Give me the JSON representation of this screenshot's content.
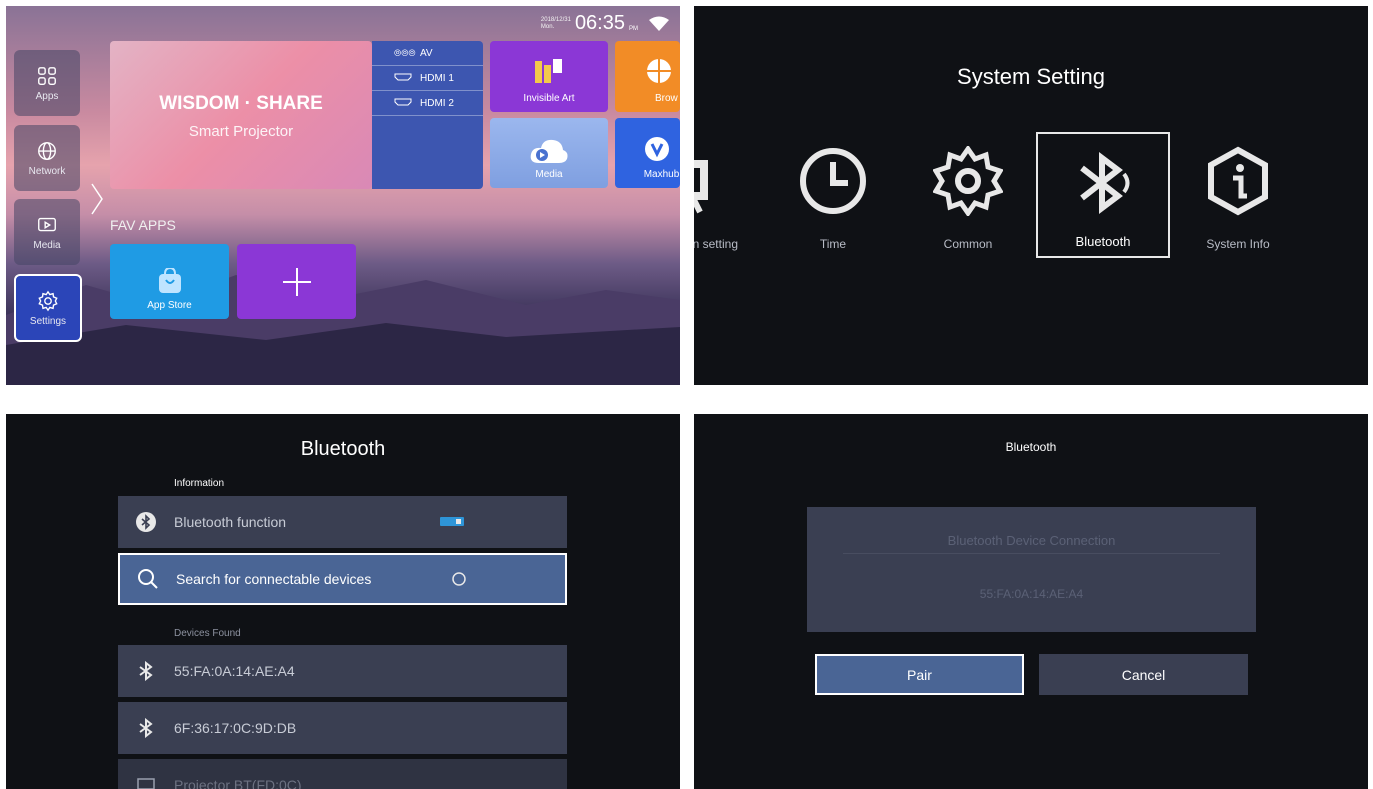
{
  "panel1": {
    "status": {
      "date": "2018/12/31",
      "weekday": "Mon.",
      "time": "06:35",
      "ampm": "PM"
    },
    "sidebar": [
      {
        "label": "Apps",
        "icon": "apps-grid-icon"
      },
      {
        "label": "Network",
        "icon": "globe-icon"
      },
      {
        "label": "Media",
        "icon": "media-play-icon"
      },
      {
        "label": "Settings",
        "icon": "gear-icon"
      }
    ],
    "hero": {
      "title": "WISDOM · SHARE",
      "subtitle": "Smart Projector"
    },
    "sources": [
      {
        "label": "AV",
        "icon": "av-ports-icon"
      },
      {
        "label": "HDMI 1",
        "icon": "hdmi-icon"
      },
      {
        "label": "HDMI 2",
        "icon": "hdmi-icon"
      }
    ],
    "tiles": {
      "invisible_art": "Invisible Art",
      "browser": "Brow",
      "media": "Media",
      "maxhub": "Maxhub"
    },
    "fav_apps_label": "FAV APPS",
    "app_store": "App Store"
  },
  "panel2": {
    "title": "System Setting",
    "items": [
      {
        "label": "on setting",
        "icon": "projection-icon"
      },
      {
        "label": "Time",
        "icon": "clock-icon"
      },
      {
        "label": "Common",
        "icon": "gear-icon"
      },
      {
        "label": "Bluetooth",
        "icon": "bluetooth-icon"
      },
      {
        "label": "System Info",
        "icon": "info-icon"
      }
    ]
  },
  "panel3": {
    "title": "Bluetooth",
    "information_label": "Information",
    "function_label": "Bluetooth function",
    "search_label": "Search for connectable devices",
    "devices_found_label": "Devices Found",
    "devices": [
      "55:FA:0A:14:AE:A4",
      "6F:36:17:0C:9D:DB",
      "Projector BT(FD:0C)"
    ]
  },
  "panel4": {
    "title": "Bluetooth",
    "dialog_header": "Bluetooth Device Connection",
    "dialog_value": "55:FA:0A:14:AE:A4",
    "pair": "Pair",
    "cancel": "Cancel"
  },
  "colors": {
    "accent_blue": "#2b45b8",
    "selected_row": "#4a6595",
    "row_bg": "#3a3f52"
  }
}
